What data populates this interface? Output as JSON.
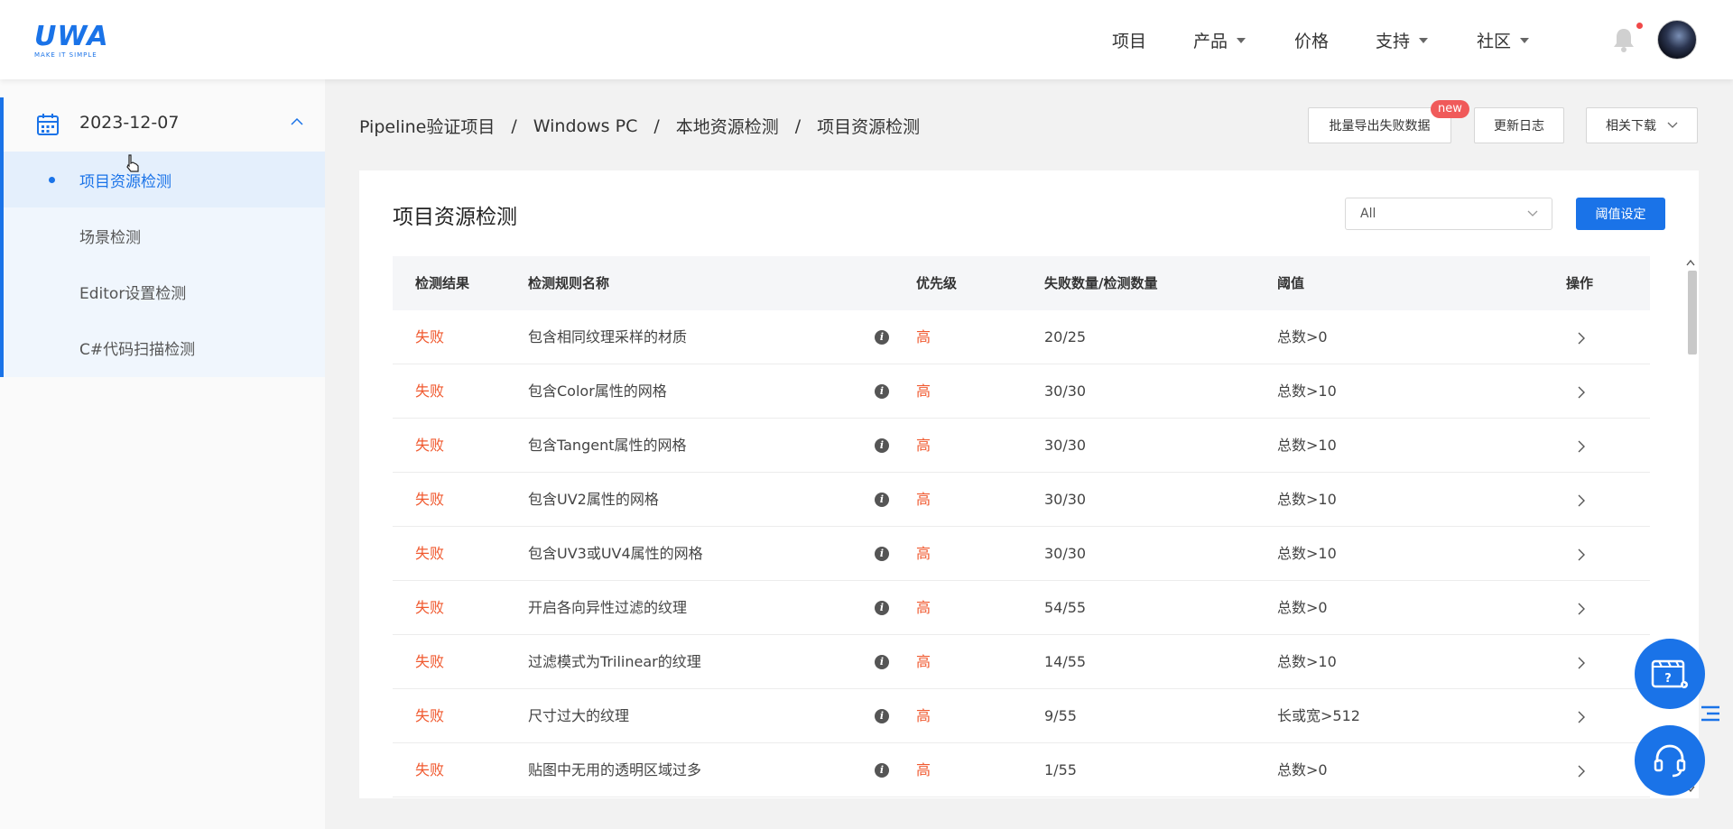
{
  "header": {
    "logo_text": "UWA",
    "logo_tagline": "MAKE IT SIMPLE",
    "nav": [
      {
        "label": "项目",
        "dropdown": false
      },
      {
        "label": "产品",
        "dropdown": true
      },
      {
        "label": "价格",
        "dropdown": false
      },
      {
        "label": "支持",
        "dropdown": true
      },
      {
        "label": "社区",
        "dropdown": true
      }
    ],
    "icons": [
      "bell-icon",
      "avatar"
    ]
  },
  "sidebar": {
    "date": "2023-12-07",
    "items": [
      {
        "label": "项目资源检测",
        "active": true
      },
      {
        "label": "场景检测",
        "active": false
      },
      {
        "label": "Editor设置检测",
        "active": false
      },
      {
        "label": "C#代码扫描检测",
        "active": false
      }
    ]
  },
  "breadcrumb": [
    "Pipeline验证项目",
    "Windows PC",
    "本地资源检测",
    "项目资源检测"
  ],
  "toolbar": {
    "export_label": "批量导出失败数据",
    "export_badge": "new",
    "changelog_label": "更新日志",
    "downloads_label": "相关下载"
  },
  "card": {
    "title": "项目资源检测",
    "filter_value": "All",
    "threshold_button": "阈值设定"
  },
  "table": {
    "headers": [
      "检测结果",
      "检测规则名称",
      "优先级",
      "失败数量/检测数量",
      "阈值",
      "操作"
    ],
    "rows": [
      {
        "result": "失败",
        "rule": "包含相同纹理采样的材质",
        "priority": "高",
        "count": "20/25",
        "threshold": "总数>0"
      },
      {
        "result": "失败",
        "rule": "包含Color属性的网格",
        "priority": "高",
        "count": "30/30",
        "threshold": "总数>10"
      },
      {
        "result": "失败",
        "rule": "包含Tangent属性的网格",
        "priority": "高",
        "count": "30/30",
        "threshold": "总数>10"
      },
      {
        "result": "失败",
        "rule": "包含UV2属性的网格",
        "priority": "高",
        "count": "30/30",
        "threshold": "总数>10"
      },
      {
        "result": "失败",
        "rule": "包含UV3或UV4属性的网格",
        "priority": "高",
        "count": "30/30",
        "threshold": "总数>10"
      },
      {
        "result": "失败",
        "rule": "开启各向异性过滤的纹理",
        "priority": "高",
        "count": "54/55",
        "threshold": "总数>0"
      },
      {
        "result": "失败",
        "rule": "过滤模式为Trilinear的纹理",
        "priority": "高",
        "count": "14/55",
        "threshold": "总数>10"
      },
      {
        "result": "失败",
        "rule": "尺寸过大的纹理",
        "priority": "高",
        "count": "9/55",
        "threshold": "长或宽>512"
      },
      {
        "result": "失败",
        "rule": "贴图中无用的透明区域过多",
        "priority": "高",
        "count": "1/55",
        "threshold": "总数>0"
      }
    ]
  },
  "colors": {
    "accent": "#1a73e8",
    "fail": "#f0592f",
    "badge": "#f05a5a"
  }
}
